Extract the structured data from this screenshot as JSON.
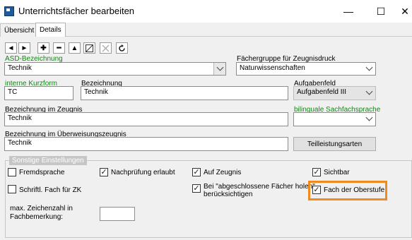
{
  "window": {
    "title": "Unterrichtsfächer bearbeiten",
    "minimize": "—",
    "maximize": "☐",
    "close": "✕"
  },
  "tabs": [
    {
      "label": "Übersicht"
    },
    {
      "label": "Details"
    }
  ],
  "toolbar": {
    "prev": "◄",
    "next": "►",
    "add": "✚",
    "remove": "━",
    "up": "▲"
  },
  "fields": {
    "asd_label": "ASD-Bezeichnung",
    "asd_value": "Technik",
    "faechergruppe_label": "Fächergruppe für Zeugnisdruck",
    "faechergruppe_value": "Naturwissenschaften",
    "kurzform_label": "interne Kurzform",
    "kurzform_value": "TC",
    "bezeichnung_label": "Bezeichnung",
    "bezeichnung_value": "Technik",
    "aufgabenfeld_label": "Aufgabenfeld",
    "aufgabenfeld_value": "Aufgabenfeld III",
    "zeugnis_label": "Bezeichnung im Zeugnis",
    "zeugnis_value": "Technik",
    "bilingual_label": "bilinguale Sachfachsprache",
    "bilingual_value": "",
    "ueberweisung_label": "Bezeichnung im Überweisungszeugnis",
    "ueberweisung_value": "Technik",
    "teilleistung_button": "Teilleistungsarten"
  },
  "settings": {
    "title": "Sonstige Einstellungen",
    "fremdsprache": {
      "label": "Fremdsprache",
      "checked": false
    },
    "nachpruefung": {
      "label": "Nachprüfung erlaubt",
      "checked": true
    },
    "auf_zeugnis": {
      "label": "Auf Zeugnis",
      "checked": true
    },
    "sichtbar": {
      "label": "Sichtbar",
      "checked": true
    },
    "schriftl": {
      "label": "Schriftl. Fach für ZK",
      "checked": false
    },
    "abgeschlossen": {
      "label_line1": "Bei \"abgeschlossene Fächer holen\"",
      "label_line2": "berücksichtigen",
      "checked": true
    },
    "oberstufe": {
      "label": "Fach der Oberstufe",
      "checked": true
    },
    "zeichenzahl_line1": "max. Zeichenzahl in",
    "zeichenzahl_line2": "Fachbemerkung:",
    "zeichenzahl_value": ""
  },
  "colors": {
    "highlight": "#f08a1e",
    "green_label": "#108a10"
  }
}
